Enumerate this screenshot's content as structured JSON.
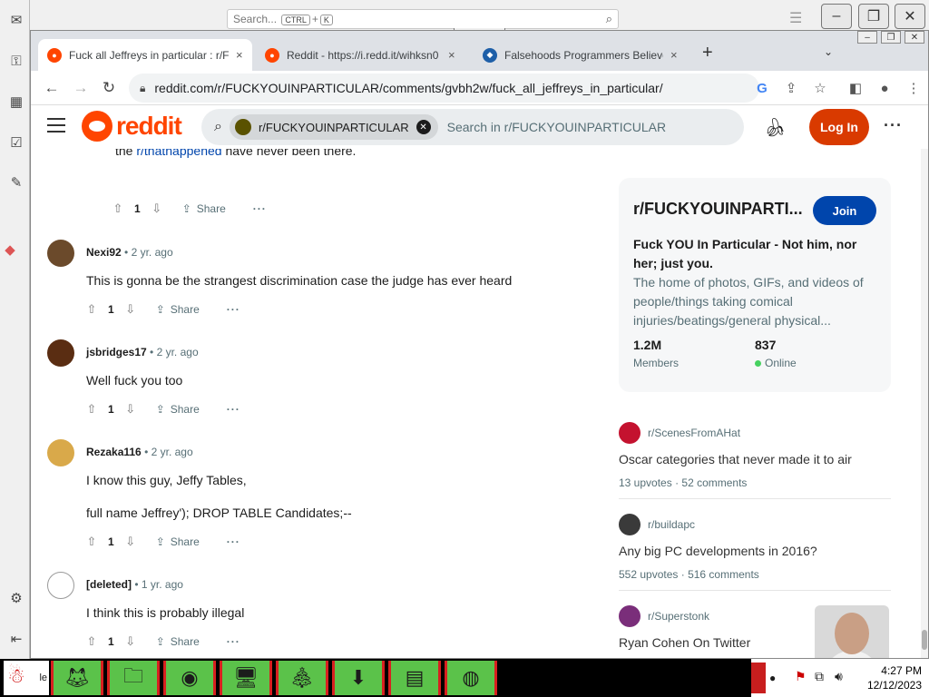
{
  "outer": {
    "search_placeholder": "Search...",
    "search_key1": "CTRL",
    "search_plus": "+",
    "search_key2": "K"
  },
  "tabs": [
    {
      "title": "Fuck all Jeffreys in particular : r/F",
      "close": "×"
    },
    {
      "title": "Reddit - https://i.redd.it/wihksn0",
      "close": "×"
    },
    {
      "title": "Falsehoods Programmers Believe",
      "close": "×"
    }
  ],
  "browser": {
    "new_tab": "+",
    "url": "reddit.com/r/FUCKYOUINPARTICULAR/comments/gvbh2w/fuck_all_jeffreys_in_particular/"
  },
  "reddit": {
    "logo_text": "reddit",
    "search_chip": "r/FUCKYOUINPARTICULAR",
    "search_placeholder": "Search in r/FUCKYOUINPARTICULAR",
    "login_label": "Log In",
    "more": "···"
  },
  "partial_comment": {
    "prefix": "the ",
    "link": "r/thathappened",
    "suffix": " have never been there.",
    "votes": "1",
    "share": "Share",
    "more": "···"
  },
  "comments": [
    {
      "author": "Nexi92",
      "sep": "•",
      "time": "2 yr. ago",
      "lines": [
        "This is gonna be the strangest discrimination case the judge has ever heard"
      ],
      "votes": "1",
      "share": "Share",
      "more": "···",
      "avatar_color": "#6b4a2b"
    },
    {
      "author": "jsbridges17",
      "sep": "•",
      "time": "2 yr. ago",
      "lines": [
        "Well fuck you too"
      ],
      "votes": "1",
      "share": "Share",
      "more": "···",
      "avatar_color": "#5a2d12"
    },
    {
      "author": "Rezaka116",
      "sep": "•",
      "time": "2 yr. ago",
      "lines": [
        "I know this guy, Jeffy Tables,",
        "full name Jeffrey'); DROP TABLE Candidates;--"
      ],
      "votes": "1",
      "share": "Share",
      "more": "···",
      "avatar_color": "#d9a94a"
    },
    {
      "author": "[deleted]",
      "sep": "•",
      "time": "1 yr. ago",
      "lines": [
        "I think this is probably illegal"
      ],
      "votes": "1",
      "share": "Share",
      "more": "···",
      "avatar_color": "#dddddd"
    }
  ],
  "sidebar": {
    "sub_name": "r/FUCKYOUINPARTI...",
    "join_label": "Join",
    "title": "Fuck YOU In Particular - Not him, nor her; just you.",
    "description": "The home of photos, GIFs, and videos of people/things taking comical injuries/beatings/general physical...",
    "members_count": "1.2M",
    "members_label": "Members",
    "online_count": "837",
    "online_label": "Online"
  },
  "related": [
    {
      "sub": "r/ScenesFromAHat",
      "title": "Oscar categories that never made it to air",
      "upvotes": "13 upvotes",
      "sep": "·",
      "comments": "52 comments",
      "icon_color": "#c4122f"
    },
    {
      "sub": "r/buildapc",
      "title": "Any big PC developments in 2016?",
      "upvotes": "552 upvotes",
      "sep": "·",
      "comments": "516 comments",
      "icon_color": "#3a3a3a"
    },
    {
      "sub": "r/Superstonk",
      "title": "Ryan Cohen On Twitter",
      "thumb_label": "twitter",
      "icon_color": "#7a2e7a"
    }
  ],
  "taskbar": {
    "start_label": "le",
    "time": "4:27 PM",
    "date": "12/12/2023"
  }
}
